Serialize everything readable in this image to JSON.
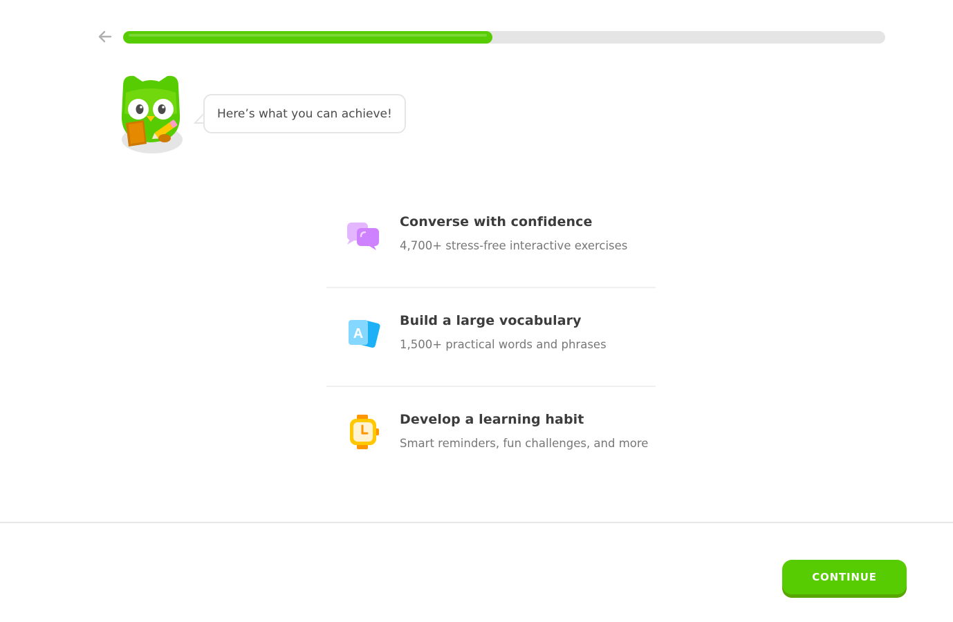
{
  "header": {
    "back_icon": "arrow-left-icon",
    "progress_fraction": 0.485
  },
  "mascot": {
    "icon": "owl-mascot-icon",
    "speech": "Here’s what you can achieve!"
  },
  "features": [
    {
      "icon": "chat-bubbles-icon",
      "title": "Converse with confidence",
      "description": "4,700+ stress-free interactive exercises"
    },
    {
      "icon": "vocabulary-cards-icon",
      "title": "Build a large vocabulary",
      "description": "1,500+ practical words and phrases"
    },
    {
      "icon": "watch-icon",
      "title": "Develop a learning habit",
      "description": "Smart reminders, fun challenges, and more"
    }
  ],
  "footer": {
    "continue_label": "CONTINUE"
  },
  "colors": {
    "accent": "#58cc02",
    "accent_shadow": "#58a700",
    "track": "#e5e5e5"
  }
}
